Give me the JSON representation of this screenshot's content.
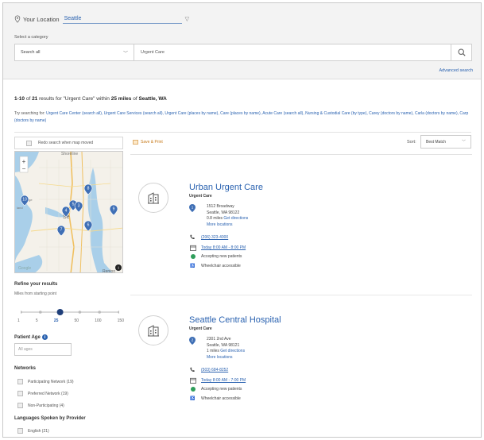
{
  "header": {
    "location_label": "Your Location",
    "location_value": "Seattle",
    "category_label": "Select a category",
    "category_value": "Search all",
    "query_value": "Urgent Care",
    "advanced_search": "Advanced search"
  },
  "results": {
    "range": "1-10",
    "of": "of",
    "total": "21",
    "text_mid": "results for \"Urgent Care\" within",
    "miles": "25 miles",
    "text_of": "of",
    "city": "Seattle, WA",
    "try_label": "Try searching for:",
    "suggestions": [
      "Urgent Care Center (search all),",
      "Urgent Care Services (search all),",
      "Urgent Care (places by name),",
      "Care (places by name),",
      "Acute Care (search all),",
      "Nursing & Custodial Care (by type),",
      "Carey (doctors by name),",
      "Carla (doctors by name),",
      "Carp (doctors by name)"
    ]
  },
  "sidebar": {
    "redo_label": "Redo search when map moved",
    "refine_title": "Refine your results",
    "miles_label": "Miles from starting point",
    "slider_values": [
      "1",
      "5",
      "25",
      "50",
      "100",
      "150"
    ],
    "slider_selected_index": 2,
    "age_label": "Patient Age",
    "age_placeholder": "All ages",
    "networks_title": "Networks",
    "networks": [
      "Participating Network (19)",
      "Preferred Network (19)",
      "Non-Participating (4)"
    ],
    "languages_title": "Languages Spoken by Provider",
    "languages": [
      "English (21)"
    ]
  },
  "map": {
    "markers": [
      "10",
      "8",
      "5",
      "3",
      "9",
      "4",
      "6",
      "7"
    ],
    "zoom_in": "+",
    "zoom_out": "−",
    "water_color": "#a9cfe9",
    "land_color": "#f4f1ea"
  },
  "toolbar": {
    "save_print": "Save & Print",
    "sort_label": "Sort:",
    "sort_value": "Best Match"
  },
  "cards": [
    {
      "title": "Urban Urgent Care",
      "type": "Urgent Care",
      "marker": "1",
      "street": "1512 Broadway",
      "city": "Seattle, WA 98122",
      "distance": "0.8 miles",
      "directions": "Get directions",
      "more": "More locations",
      "phone": "(206) 323-4000",
      "hours": "Today 8:00 AM - 8:00 PM",
      "accepting": "Accepting new patients",
      "wheelchair": "Wheelchair accessible"
    },
    {
      "title": "Seattle Central Hospital",
      "type": "Urgent Care",
      "marker": "2",
      "street": "2301 2nd Ave",
      "city": "Seattle, WA 98121",
      "distance": "1 miles",
      "directions": "Get directions",
      "more": "More locations",
      "phone": "(503) 684-8252",
      "hours": "Today 8:00 AM - 7:00 PM",
      "accepting": "Accepting new patients",
      "wheelchair": "Wheelchair accessible"
    }
  ],
  "colors": {
    "link": "#2a62b0",
    "marker": "#3f6fb5",
    "accepting": "#2f9e5b"
  }
}
